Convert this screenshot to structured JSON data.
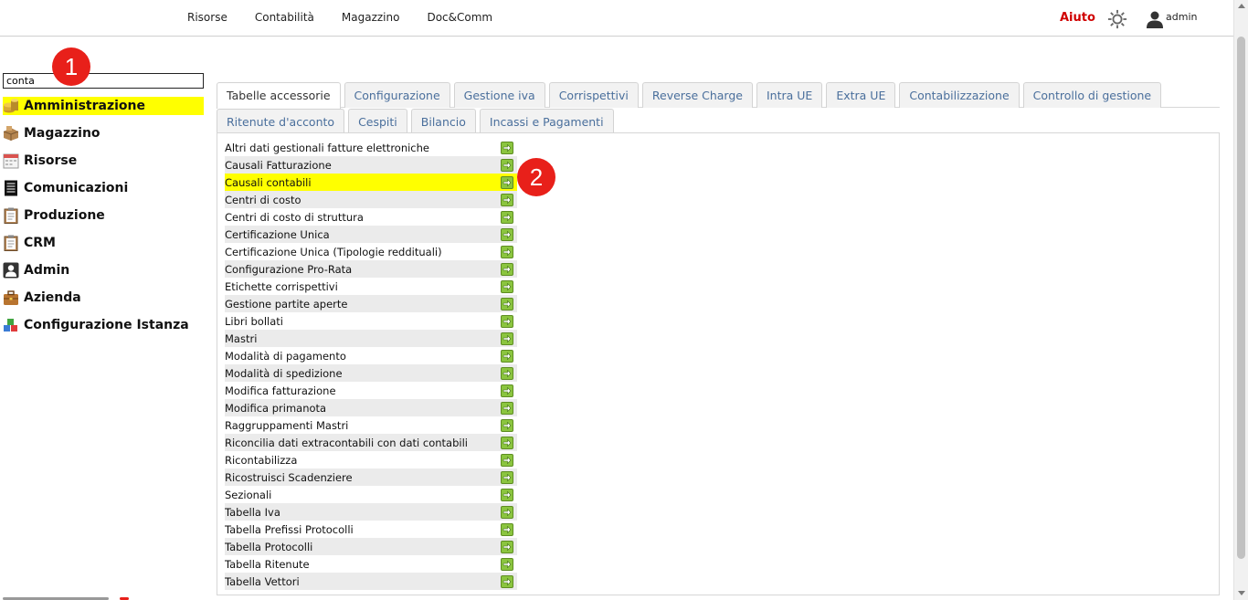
{
  "topnav": {
    "items": [
      "Risorse",
      "Contabilità",
      "Magazzino",
      "Doc&Comm"
    ],
    "help": "Aiuto",
    "settings_icon": "gear-icon",
    "user": "admin"
  },
  "search": {
    "value": "conta",
    "placeholder": ""
  },
  "badges": {
    "first": "1",
    "second": "2",
    "color": "#e8201a"
  },
  "sidebar": {
    "items": [
      {
        "label": "Amministrazione",
        "icon": "coins-icon",
        "active": true
      },
      {
        "label": "Magazzino",
        "icon": "boxes-icon"
      },
      {
        "label": "Risorse",
        "icon": "calendar-icon"
      },
      {
        "label": "Comunicazioni",
        "icon": "document-icon"
      },
      {
        "label": "Produzione",
        "icon": "clipboard-icon"
      },
      {
        "label": "CRM",
        "icon": "clipboard-icon"
      },
      {
        "label": "Admin",
        "icon": "user-icon"
      },
      {
        "label": "Azienda",
        "icon": "briefcase-icon"
      },
      {
        "label": "Configurazione Istanza",
        "icon": "blocks-icon"
      }
    ]
  },
  "tabs": {
    "row1": [
      "Tabelle accessorie",
      "Configurazione",
      "Gestione iva",
      "Corrispettivi",
      "Reverse Charge",
      "Intra UE",
      "Extra UE",
      "Contabilizzazione",
      "Controllo di gestione"
    ],
    "row2": [
      "Ritenute d'acconto",
      "Cespiti",
      "Bilancio",
      "Incassi e Pagamenti"
    ],
    "active": "Tabelle accessorie"
  },
  "list": {
    "highlighted": "Causali contabili",
    "items": [
      "Altri dati gestionali fatture elettroniche",
      "Causali Fatturazione",
      "Causali contabili",
      "Centri di costo",
      "Centri di costo di struttura",
      "Certificazione Unica",
      "Certificazione Unica (Tipologie reddituali)",
      "Configurazione Pro-Rata",
      "Etichette corrispettivi",
      "Gestione partite aperte",
      "Libri bollati",
      "Mastri",
      "Modalità di pagamento",
      "Modalità di spedizione",
      "Modifica fatturazione",
      "Modifica primanota",
      "Raggruppamenti Mastri",
      "Riconcilia dati extracontabili con dati contabili",
      "Ricontabilizza",
      "Ricostruisci Scadenziere",
      "Sezionali",
      "Tabella Iva",
      "Tabella Prefissi Protocolli",
      "Tabella Protocolli",
      "Tabella Ritenute",
      "Tabella Vettori"
    ],
    "go_icon": "arrow-right-icon"
  },
  "colors": {
    "highlight": "#ffff00",
    "tab_text": "#4a6f9c",
    "go_button": "#8bc53f",
    "help": "#d00000"
  }
}
